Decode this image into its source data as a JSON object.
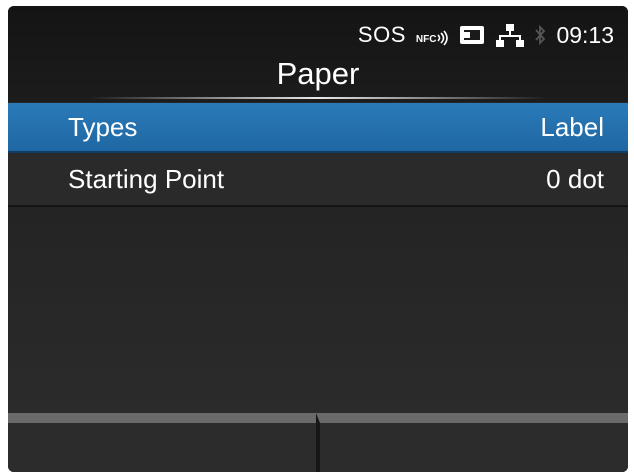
{
  "status": {
    "sos": "SOS",
    "nfc": "NFC",
    "time": "09:13",
    "icons": [
      "nfc-icon",
      "sd-card-icon",
      "network-icon",
      "bluetooth-icon"
    ]
  },
  "header": {
    "title": "Paper"
  },
  "menu": {
    "items": [
      {
        "label": "Types",
        "value": "Label",
        "selected": true
      },
      {
        "label": "Starting Point",
        "value": "0 dot",
        "selected": false
      }
    ]
  },
  "colors": {
    "selection": "#2373b0",
    "background": "#262626",
    "softkey_bar": "#6a6a6a"
  }
}
